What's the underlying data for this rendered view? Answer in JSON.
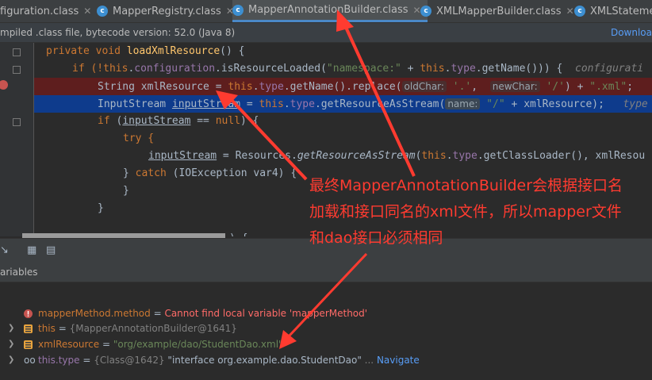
{
  "tabs": [
    {
      "label": "figuration.class"
    },
    {
      "label": "MapperRegistry.class"
    },
    {
      "label": "MapperAnnotationBuilder.class"
    },
    {
      "label": "XMLMapperBuilder.class"
    },
    {
      "label": "XMLStatemen"
    }
  ],
  "banner": {
    "message": "mpiled .class file, bytecode version: 52.0 (Java 8)",
    "download": "Downloa"
  },
  "code": {
    "l1_mod": "private void ",
    "l1_fn": "loadXmlResource",
    "l1_rest": "() {",
    "l2_a": "if (!",
    "l2_this": "this",
    "l2_b": ".",
    "l2_conf": "configuration",
    "l2_c": ".isResourceLoaded(",
    "l2_str": "\"namespace:\"",
    "l2_d": " + ",
    "l2_this2": "this",
    "l2_e": ".",
    "l2_type": "type",
    "l2_f": ".getName())) {  ",
    "l2_cm": "configurati",
    "l3_a": "String xmlResource = ",
    "l3_this": "this",
    "l3_b": ".",
    "l3_type": "type",
    "l3_c": ".getName().replace(",
    "l3_h1": "oldChar:",
    "l3_s1": " '.'",
    "l3_d": ",  ",
    "l3_h2": "newChar:",
    "l3_s2": " '/'",
    "l3_e": ") + ",
    "l3_s3": "\".xml\"",
    "l3_f": ";   x",
    "l4_a": "InputStream ",
    "l4_var": "inputStream",
    "l4_b": " = ",
    "l4_this": "this",
    "l4_c": ".",
    "l4_type": "type",
    "l4_d": ".getResourceAsStream(",
    "l4_h": "name:",
    "l4_s": " \"/\"",
    "l4_e": " + xmlResource);   ",
    "l4_cm": "type",
    "l5_kw": "if",
    "l5_a": " (",
    "l5_var": "inputStream",
    "l5_b": " == ",
    "l5_null": "null",
    "l5_c": ") {",
    "l6": "try {",
    "l7_var": "inputStream",
    "l7_a": " = Resources.",
    "l7_fn": "getResourceAsStream",
    "l7_b": "(",
    "l7_this": "this",
    "l7_c": ".",
    "l7_type": "type",
    "l7_d": ".getClassLoader(), xmlResou",
    "l8_a": "} ",
    "l8_kw": "catch",
    "l8_b": " (IOException var4) {",
    "l9": "}",
    "l10": "}",
    "l11": ") {"
  },
  "variables_header": "ariables",
  "variables": [
    {
      "name": "mapperMethod.method",
      "eq": " = ",
      "value": "Cannot find local variable 'mapperMethod'"
    },
    {
      "name": "this",
      "eq": " = ",
      "value": "{MapperAnnotationBuilder@1641}"
    },
    {
      "name": "xmlResource",
      "eq": " = ",
      "value": "\"org/example/dao/StudentDao.xml\""
    },
    {
      "name": "this.type",
      "eq": " = ",
      "value_ref": "{Class@1642}",
      "value": " \"interface org.example.dao.StudentDao\"",
      "more": " ... ",
      "link": "Navigate"
    }
  ],
  "annotation": {
    "line1": "最终MapperAnnotationBuilder会根据接口名",
    "line2": "加载和接口同名的xml文件，所以mapper文件",
    "line3": "和dao接口必须相同"
  },
  "colors": {
    "annotation": "#ff3b30",
    "breakpoint_line": "#5e1e1e",
    "exec_line": "#0e3b8c"
  }
}
